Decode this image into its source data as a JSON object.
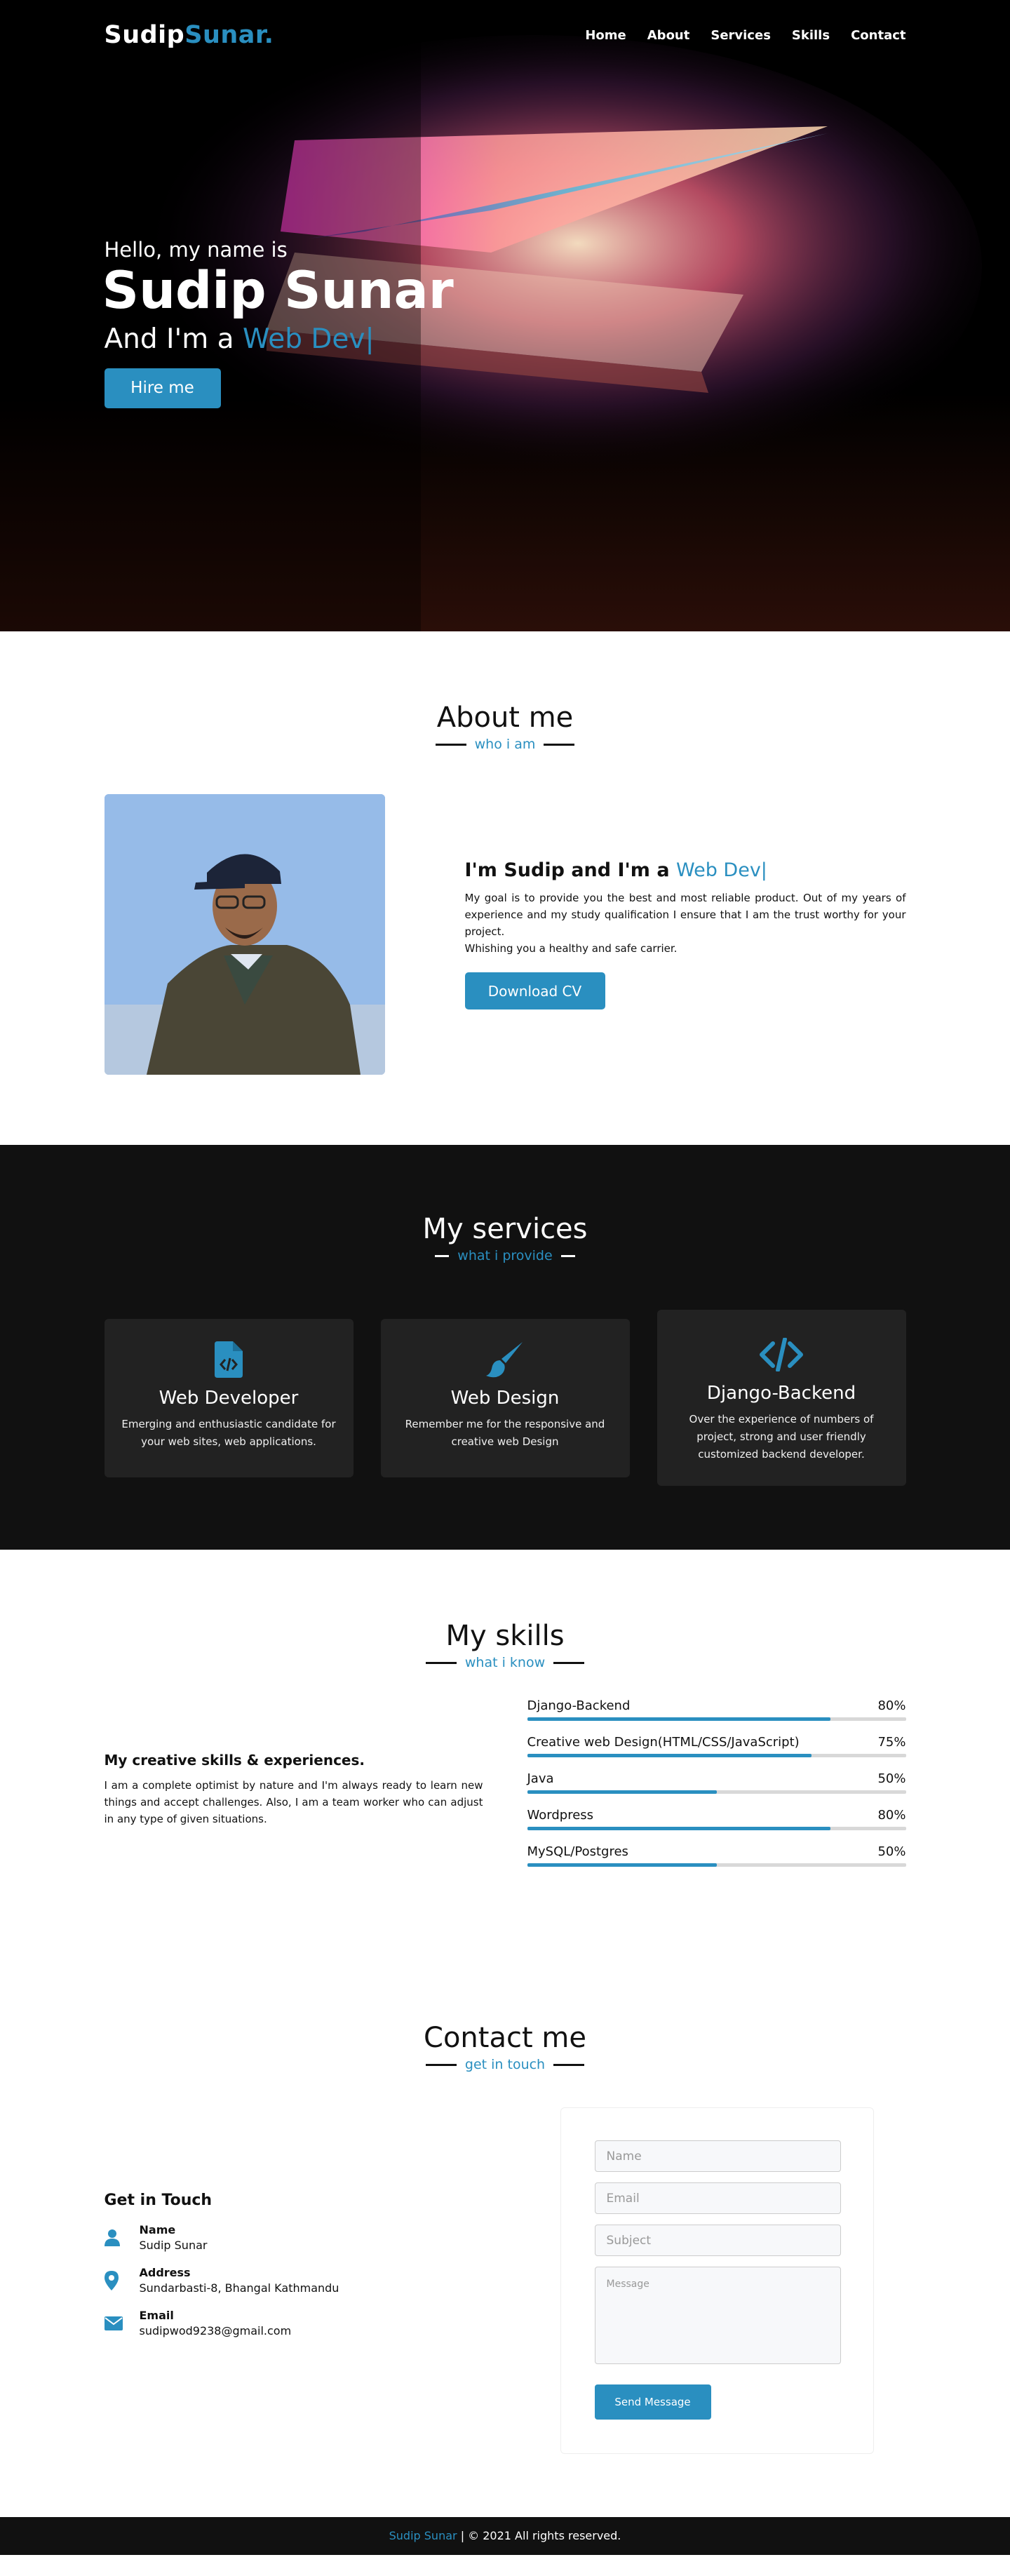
{
  "nav": {
    "logo_main": "Sudip",
    "logo_accent": "Sunar.",
    "items": [
      "Home",
      "About",
      "Services",
      "Skills",
      "Contact"
    ]
  },
  "home": {
    "greeting": "Hello, my name is",
    "name": "Sudip Sunar",
    "role_prefix": "And I'm a",
    "role": "Web Dev|",
    "hire_button": "Hire me"
  },
  "about": {
    "title": "About me",
    "subtitle": "who i am",
    "heading_prefix": "I'm Sudip and I'm a",
    "heading_role": "Web Dev|",
    "paragraph_1": "My goal is to provide you the best and most reliable product. Out of my years of experience and my study qualification I ensure that I am the trust worthy for your project.",
    "paragraph_2": "Whishing you a healthy and safe carrier.",
    "download_button": "Download CV"
  },
  "services": {
    "title": "My services",
    "subtitle": "what i provide",
    "cards": [
      {
        "icon": "file-code-icon",
        "title": "Web Developer",
        "desc": "Emerging and enthusiastic candidate for your web sites, web applications."
      },
      {
        "icon": "paint-brush-icon",
        "title": "Web Design",
        "desc": "Remember me for the responsive and creative web Design"
      },
      {
        "icon": "code-icon",
        "title": "Django-Backend",
        "desc": "Over the experience of numbers of project, strong and user friendly customized backend developer."
      }
    ]
  },
  "skills": {
    "title": "My skills",
    "subtitle": "what i know",
    "heading": "My creative skills & experiences.",
    "paragraph": "I am a complete optimist by nature and I'm always ready to learn new things and accept challenges. Also, I am a team worker who can adjust in any type of given situations.",
    "bars": [
      {
        "name": "Django-Backend",
        "percent": "80%",
        "level": 80
      },
      {
        "name": "Creative web Design(HTML/CSS/JavaScript)",
        "percent": "75%",
        "level": 75
      },
      {
        "name": "Java",
        "percent": "50%",
        "level": 50
      },
      {
        "name": "Wordpress",
        "percent": "80%",
        "level": 80
      },
      {
        "name": "MySQL/Postgres",
        "percent": "50%",
        "level": 50
      }
    ]
  },
  "contact": {
    "title": "Contact me",
    "subtitle": "get in touch",
    "heading": "Get in Touch",
    "info": [
      {
        "icon": "user-icon",
        "label": "Name",
        "value": "Sudip Sunar"
      },
      {
        "icon": "map-marker-icon",
        "label": "Address",
        "value": "Sundarbasti-8, Bhangal Kathmandu"
      },
      {
        "icon": "envelope-icon",
        "label": "Email",
        "value": "sudipwod9238@gmail.com"
      }
    ],
    "form": {
      "name_placeholder": "Name",
      "email_placeholder": "Email",
      "subject_placeholder": "Subject",
      "message_placeholder": "Message",
      "send_button": "Send Message"
    }
  },
  "footer": {
    "name": "Sudip Sunar",
    "text": "| © 2021 All rights reserved."
  },
  "colors": {
    "accent": "#2a8fc0",
    "dark": "#111111",
    "card": "#222222"
  }
}
